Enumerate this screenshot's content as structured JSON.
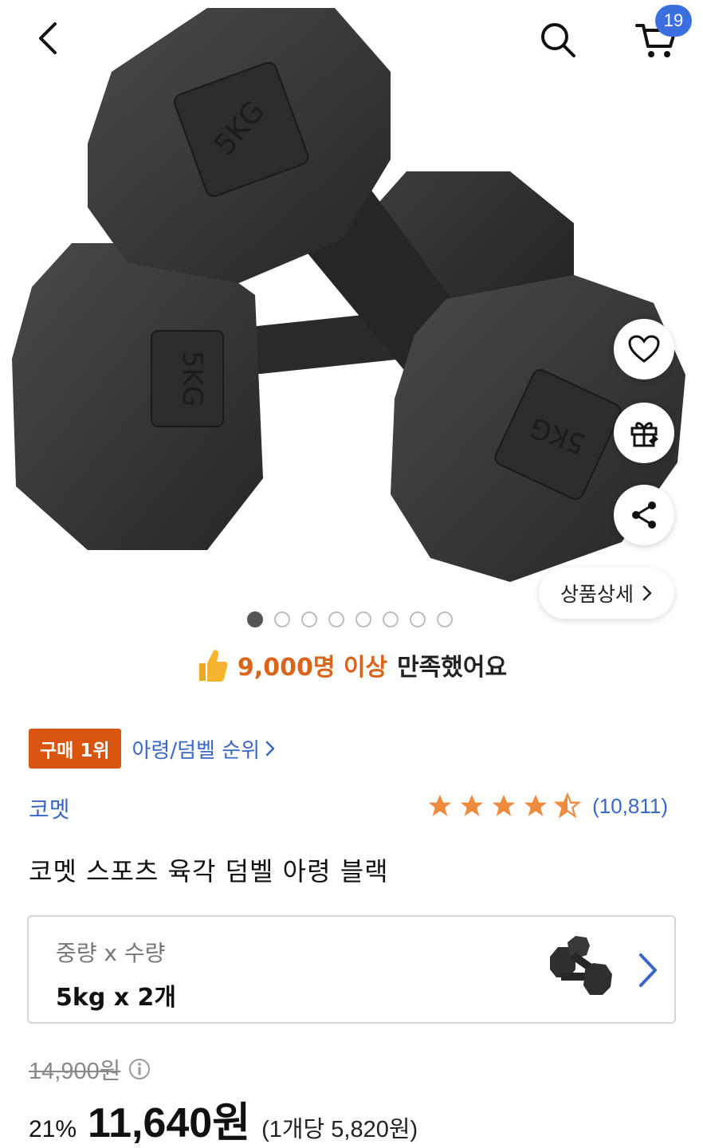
{
  "header": {
    "cart_count": "19"
  },
  "hero": {
    "weight_label": "5KG",
    "page_count": 8,
    "active_page": 1,
    "detail_button_label": "상품상세"
  },
  "satisfaction": {
    "count_text": "9,000명 이상",
    "rest_text": "만족했어요"
  },
  "ranking": {
    "badge": "구매 1위",
    "category_link": "아령/덤벨 순위"
  },
  "brand": "코멧",
  "rating": {
    "stars": 4.5,
    "count_text": "(10,811)"
  },
  "product_title": "코멧 스포츠 육각 덤벨 아령 블랙",
  "option": {
    "label": "중량 x 수량",
    "value": "5kg x 2개"
  },
  "price": {
    "original": "14,900원",
    "discount": "21%",
    "sale": "11,640원",
    "unit": "(1개당 5,820원)"
  },
  "colors": {
    "accent_blue": "#3a66c8",
    "badge_orange": "#d9550f",
    "star_orange": "#f08a3c",
    "cart_badge": "#3b6fe0"
  }
}
